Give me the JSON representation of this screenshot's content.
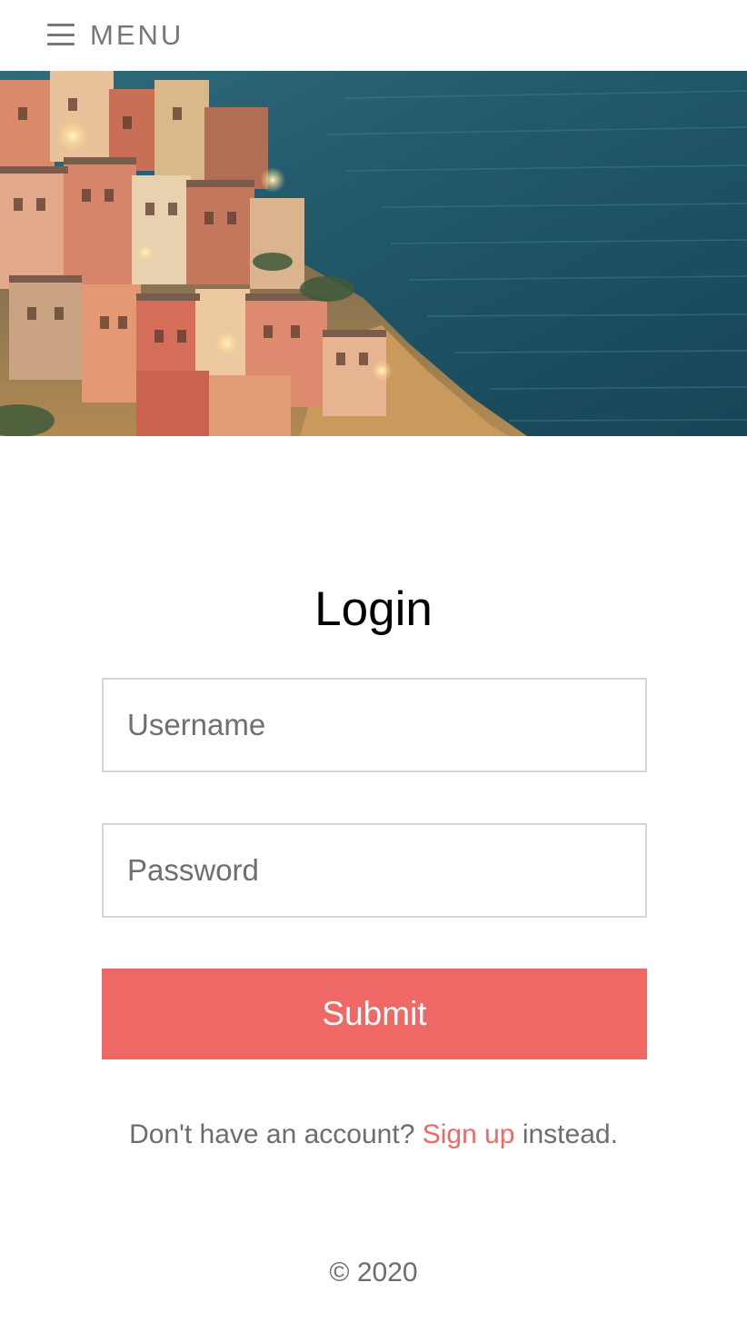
{
  "header": {
    "menu_icon": "hamburger-icon",
    "menu_label": "MENU"
  },
  "hero": {
    "image": "coastal-village-photo"
  },
  "login": {
    "title": "Login",
    "username_placeholder": "Username",
    "username_value": "",
    "password_placeholder": "Password",
    "password_value": "",
    "submit_label": "Submit",
    "signup_prefix": "Don't have an account?",
    "signup_link": "Sign up",
    "signup_suffix": "instead."
  },
  "footer": {
    "copyright": "© 2020"
  },
  "colors": {
    "accent": "#ee6965",
    "text_muted": "#6d6d6d",
    "menu_gray": "#777777",
    "input_border": "#d7d7d7"
  }
}
